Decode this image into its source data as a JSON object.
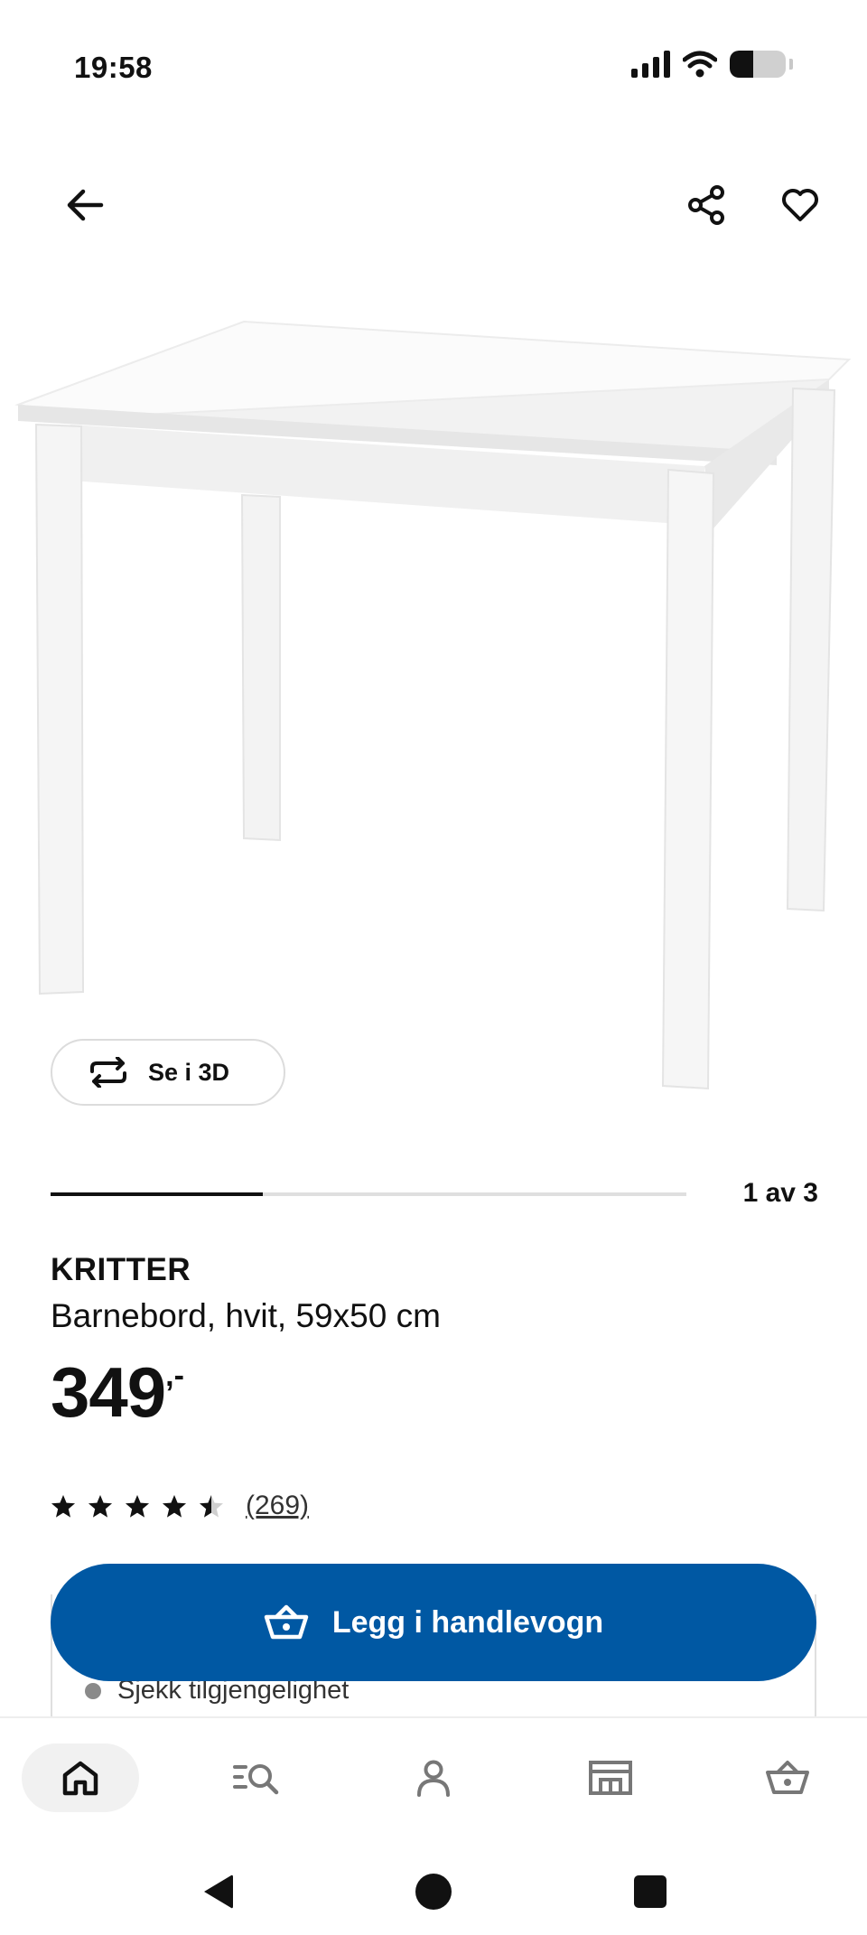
{
  "status_bar": {
    "time": "19:58"
  },
  "product": {
    "brand": "KRITTER",
    "description": "Barnebord, hvit, 59x50 cm",
    "price": "349",
    "price_suffix": ",-",
    "rating_value": 4.5,
    "rating_max": 5,
    "rating_count": "(269)"
  },
  "view3d": {
    "label": "Se i 3D"
  },
  "carousel": {
    "counter": "1 av 3",
    "current": 1,
    "total": 3
  },
  "actions": {
    "add_to_cart_label": "Legg i handlevogn"
  },
  "availability": {
    "text": "Sjekk tilgjengelighet"
  },
  "icons": {
    "back": "arrow-left-icon",
    "share": "share-icon",
    "favorite": "heart-icon",
    "view3d": "rotate-icon",
    "cart": "basket-icon"
  },
  "bottom_nav": [
    {
      "name": "home",
      "icon": "home-icon",
      "active": true
    },
    {
      "name": "search",
      "icon": "search-list-icon",
      "active": false
    },
    {
      "name": "account",
      "icon": "person-icon",
      "active": false
    },
    {
      "name": "stores",
      "icon": "store-icon",
      "active": false
    },
    {
      "name": "cart",
      "icon": "basket-icon",
      "active": false
    }
  ],
  "colors": {
    "primary": "#0058a3",
    "text": "#111111",
    "muted": "#8a8a8a"
  }
}
